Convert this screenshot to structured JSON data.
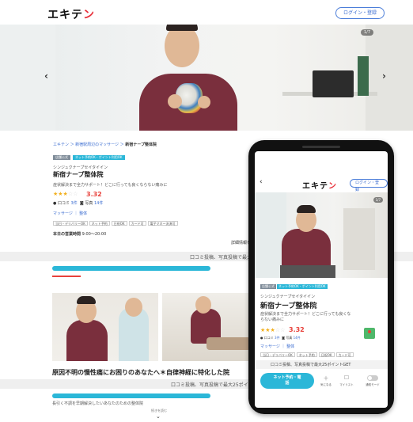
{
  "site": {
    "logo_main": "エキテ",
    "logo_accent": "ン",
    "login_label": "ログイン・登録"
  },
  "hero": {
    "counter": "1/7",
    "prev_arrow": "‹",
    "next_arrow": "›"
  },
  "shop": {
    "breadcrumb_link": "エキテン ＞ 新宿駅周辺のマッサージ ＞",
    "breadcrumb_current": "新宿ナープ整体院",
    "tag1": "店舗公式",
    "tag2": "ネット予約OK・ポイント利用OK",
    "sub_name": "シンジュクナープセイタイイン",
    "name": "新宿ナープ整体院",
    "catch": "症状解決まで全力サポート！どこに行っても良くならない痛みに",
    "catch_mobile": "症状解決まで全力サポート！どこに行っても良くならない痛みに",
    "stars_on": "★★★",
    "stars_off": "☆☆",
    "rating": "3.32",
    "review_label": "● 口コミ",
    "review_count": "3件",
    "photo_label": "写真",
    "photo_count": "14件",
    "category1": "マッサージ",
    "category2": "整体",
    "chips": [
      "当日・デリバリーOK",
      "ネット予約",
      "日祝OK",
      "カード可",
      "電子マネー決済可"
    ],
    "chips_mobile": [
      "当日・デリバリーOK",
      "ネット予約",
      "日祝OK",
      "カード可"
    ],
    "hours_label": "本日の営業時間",
    "hours_value": "9:00〜20:00",
    "links_right": "詳細情報を"
  },
  "banners": {
    "review_points": "口コミ投稿、写真投稿で最大25ポイント",
    "review_points_2": "口コミ投稿、写真投稿で最大25ポイント",
    "review_points_mobile": "口コミ投稿、写真投稿で最大25ポイントGET"
  },
  "content": {
    "section_title": "原因不明の慢性痛にお困りのあなたへ＊自律神経に特化した院",
    "desc": "長引く不調を早期解決したいあなたのための整体院",
    "read_more": "続きを読む",
    "read_more_icon": "⌄"
  },
  "mobile": {
    "back": "‹",
    "cta_line1": "ネット予約・電",
    "cta_line2": "話",
    "fav_label": "気になる",
    "fav_icon": "＋",
    "mylist_label": "マイリスト",
    "mylist_icon": "☐",
    "notify_label": "通知モード"
  },
  "colors": {
    "accent_red": "#e8313b",
    "link_blue": "#3a6cd0",
    "cta_cyan": "#2bb7d8",
    "star": "#f2b01e",
    "coat": "#7a2f3d"
  }
}
